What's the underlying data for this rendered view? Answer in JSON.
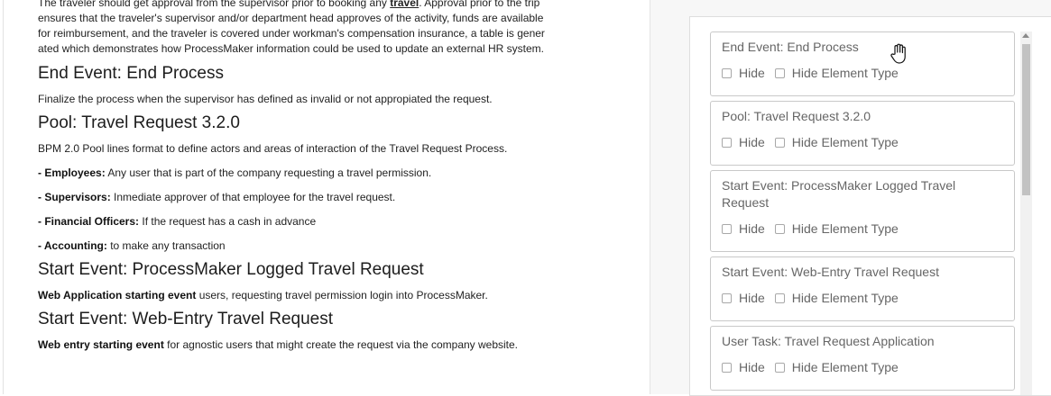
{
  "document": {
    "intro_lines": [
      "The traveler should get approval from the supervisor prior to booking any ",
      "travel",
      ". Approval prior to the trip",
      "ensures that the traveler's supervisor and/or department head approves of the activity, funds are available",
      "for reimbursement, and the traveler is covered under workman's compensation insurance, a table is gener",
      "ated which demonstrates how ProcessMaker information could be used to update an external HR system."
    ],
    "sections": [
      {
        "heading": "End Event: End Process",
        "text": "Finalize the process when the supervisor has defined as invalid or not appropiated the request."
      },
      {
        "heading": "Pool: Travel Request 3.2.0",
        "text": "BPM 2.0 Pool lines format to define actors and areas of interaction of the Travel Request Process."
      }
    ],
    "roles": [
      {
        "label": "- Employees:",
        "text": " Any user that is part of the company requesting a travel permission."
      },
      {
        "label": "- Supervisors:",
        "text": " Inmediate approver of that employee for the travel request."
      },
      {
        "label": "- Financial Officers:",
        "text": " If the request has a cash in advance"
      },
      {
        "label": "- Accounting:",
        "text": " to make any transaction"
      }
    ],
    "start_events": [
      {
        "heading": "Start Event: ProcessMaker Logged Travel Request",
        "bold": "Web Application starting event",
        "text": " users, requesting travel permission login into ProcessMaker."
      },
      {
        "heading": "Start Event: Web-Entry Travel Request",
        "bold": "Web entry starting event",
        "text": " for agnostic users that might create the request via the company website."
      }
    ]
  },
  "options": {
    "hide_label": "Hide",
    "hide_type_label": "Hide Element Type",
    "cards": [
      {
        "title": "End Event: End Process"
      },
      {
        "title": "Pool: Travel Request 3.2.0"
      },
      {
        "title": "Start Event: ProcessMaker Logged Travel Request"
      },
      {
        "title": "Start Event: Web-Entry Travel Request"
      },
      {
        "title": "User Task: Travel Request Application"
      }
    ]
  }
}
